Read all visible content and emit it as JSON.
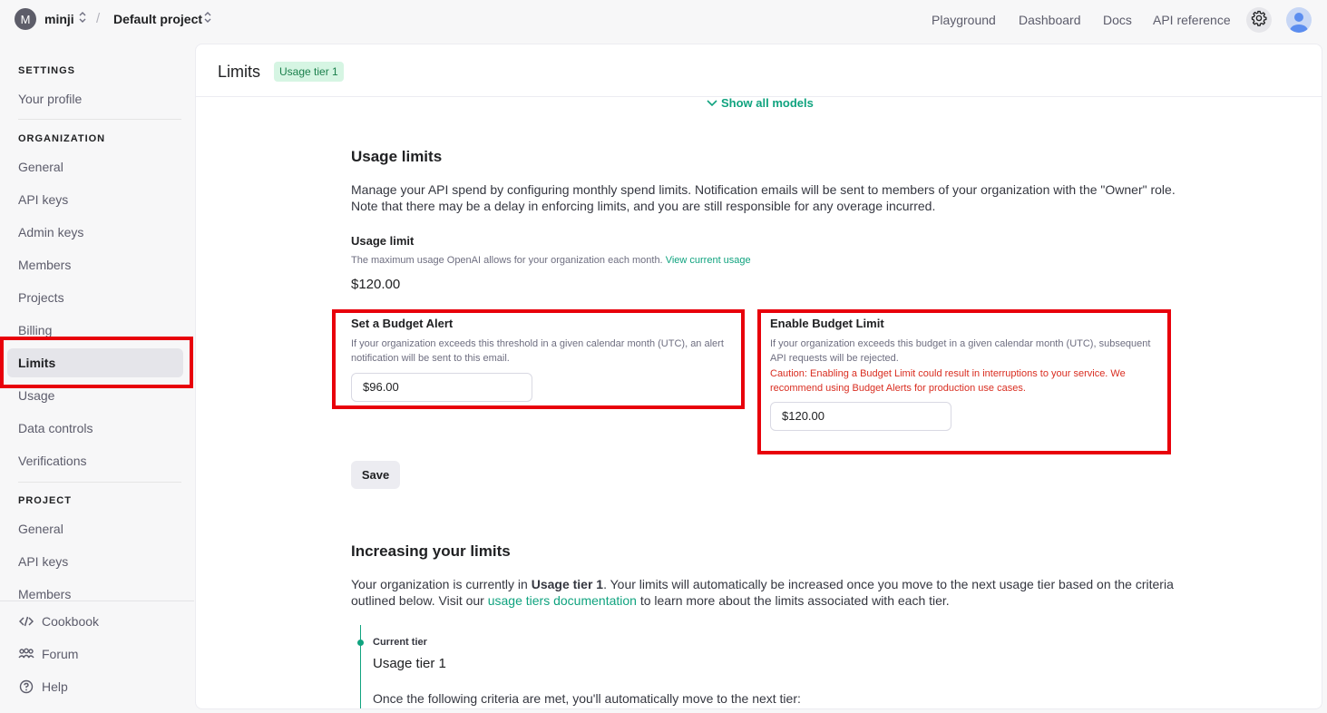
{
  "topbar": {
    "org_initial": "M",
    "org_name": "minji",
    "separator": "/",
    "project_name": "Default project",
    "links": [
      "Playground",
      "Dashboard",
      "Docs",
      "API reference"
    ]
  },
  "sidebar": {
    "settings_heading": "SETTINGS",
    "your_profile": "Your profile",
    "organization_heading": "ORGANIZATION",
    "org_items": [
      "General",
      "API keys",
      "Admin keys",
      "Members",
      "Projects",
      "Billing",
      "Limits",
      "Usage",
      "Data controls",
      "Verifications"
    ],
    "active_item": "Limits",
    "project_heading": "PROJECT",
    "project_items": [
      "General",
      "API keys",
      "Members"
    ],
    "footer": [
      {
        "label": "Cookbook",
        "icon": "code-icon"
      },
      {
        "label": "Forum",
        "icon": "people-icon"
      },
      {
        "label": "Help",
        "icon": "help-icon"
      }
    ]
  },
  "main": {
    "title": "Limits",
    "tier_badge": "Usage tier 1",
    "show_all_models": "Show all models",
    "usage_limits": {
      "heading": "Usage limits",
      "description": "Manage your API spend by configuring monthly spend limits. Notification emails will be sent to members of your organization with the \"Owner\" role. Note that there may be a delay in enforcing limits, and you are still responsible for any overage incurred.",
      "usage_limit_label": "Usage limit",
      "usage_limit_help": "The maximum usage OpenAI allows for your organization each month.",
      "view_current_usage": "View current usage",
      "usage_limit_value": "$120.00"
    },
    "budget_alert": {
      "label": "Set a Budget Alert",
      "help": "If your organization exceeds this threshold in a given calendar month (UTC), an alert notification will be sent to this email.",
      "value": "$96.00"
    },
    "budget_limit": {
      "label": "Enable Budget Limit",
      "help": "If your organization exceeds this budget in a given calendar month (UTC), subsequent API requests will be rejected.",
      "caution": "Caution: Enabling a Budget Limit could result in interruptions to your service. We recommend using Budget Alerts for production use cases.",
      "value": "$120.00"
    },
    "save_label": "Save",
    "increasing": {
      "heading": "Increasing your limits",
      "text_1": "Your organization is currently in ",
      "tier_bold": "Usage tier 1",
      "text_2": ". Your limits will automatically be increased once you move to the next usage tier based on the criteria outlined below. Visit our ",
      "docs_link": "usage tiers documentation",
      "text_3": " to learn more about the limits associated with each tier.",
      "current_tier_label": "Current tier",
      "current_tier_name": "Usage tier 1",
      "criteria_text": "Once the following criteria are met, you'll automatically move to the next tier:"
    }
  },
  "colors": {
    "accent": "#10a37f",
    "highlight": "#e8000b",
    "caution": "#d92d20"
  }
}
